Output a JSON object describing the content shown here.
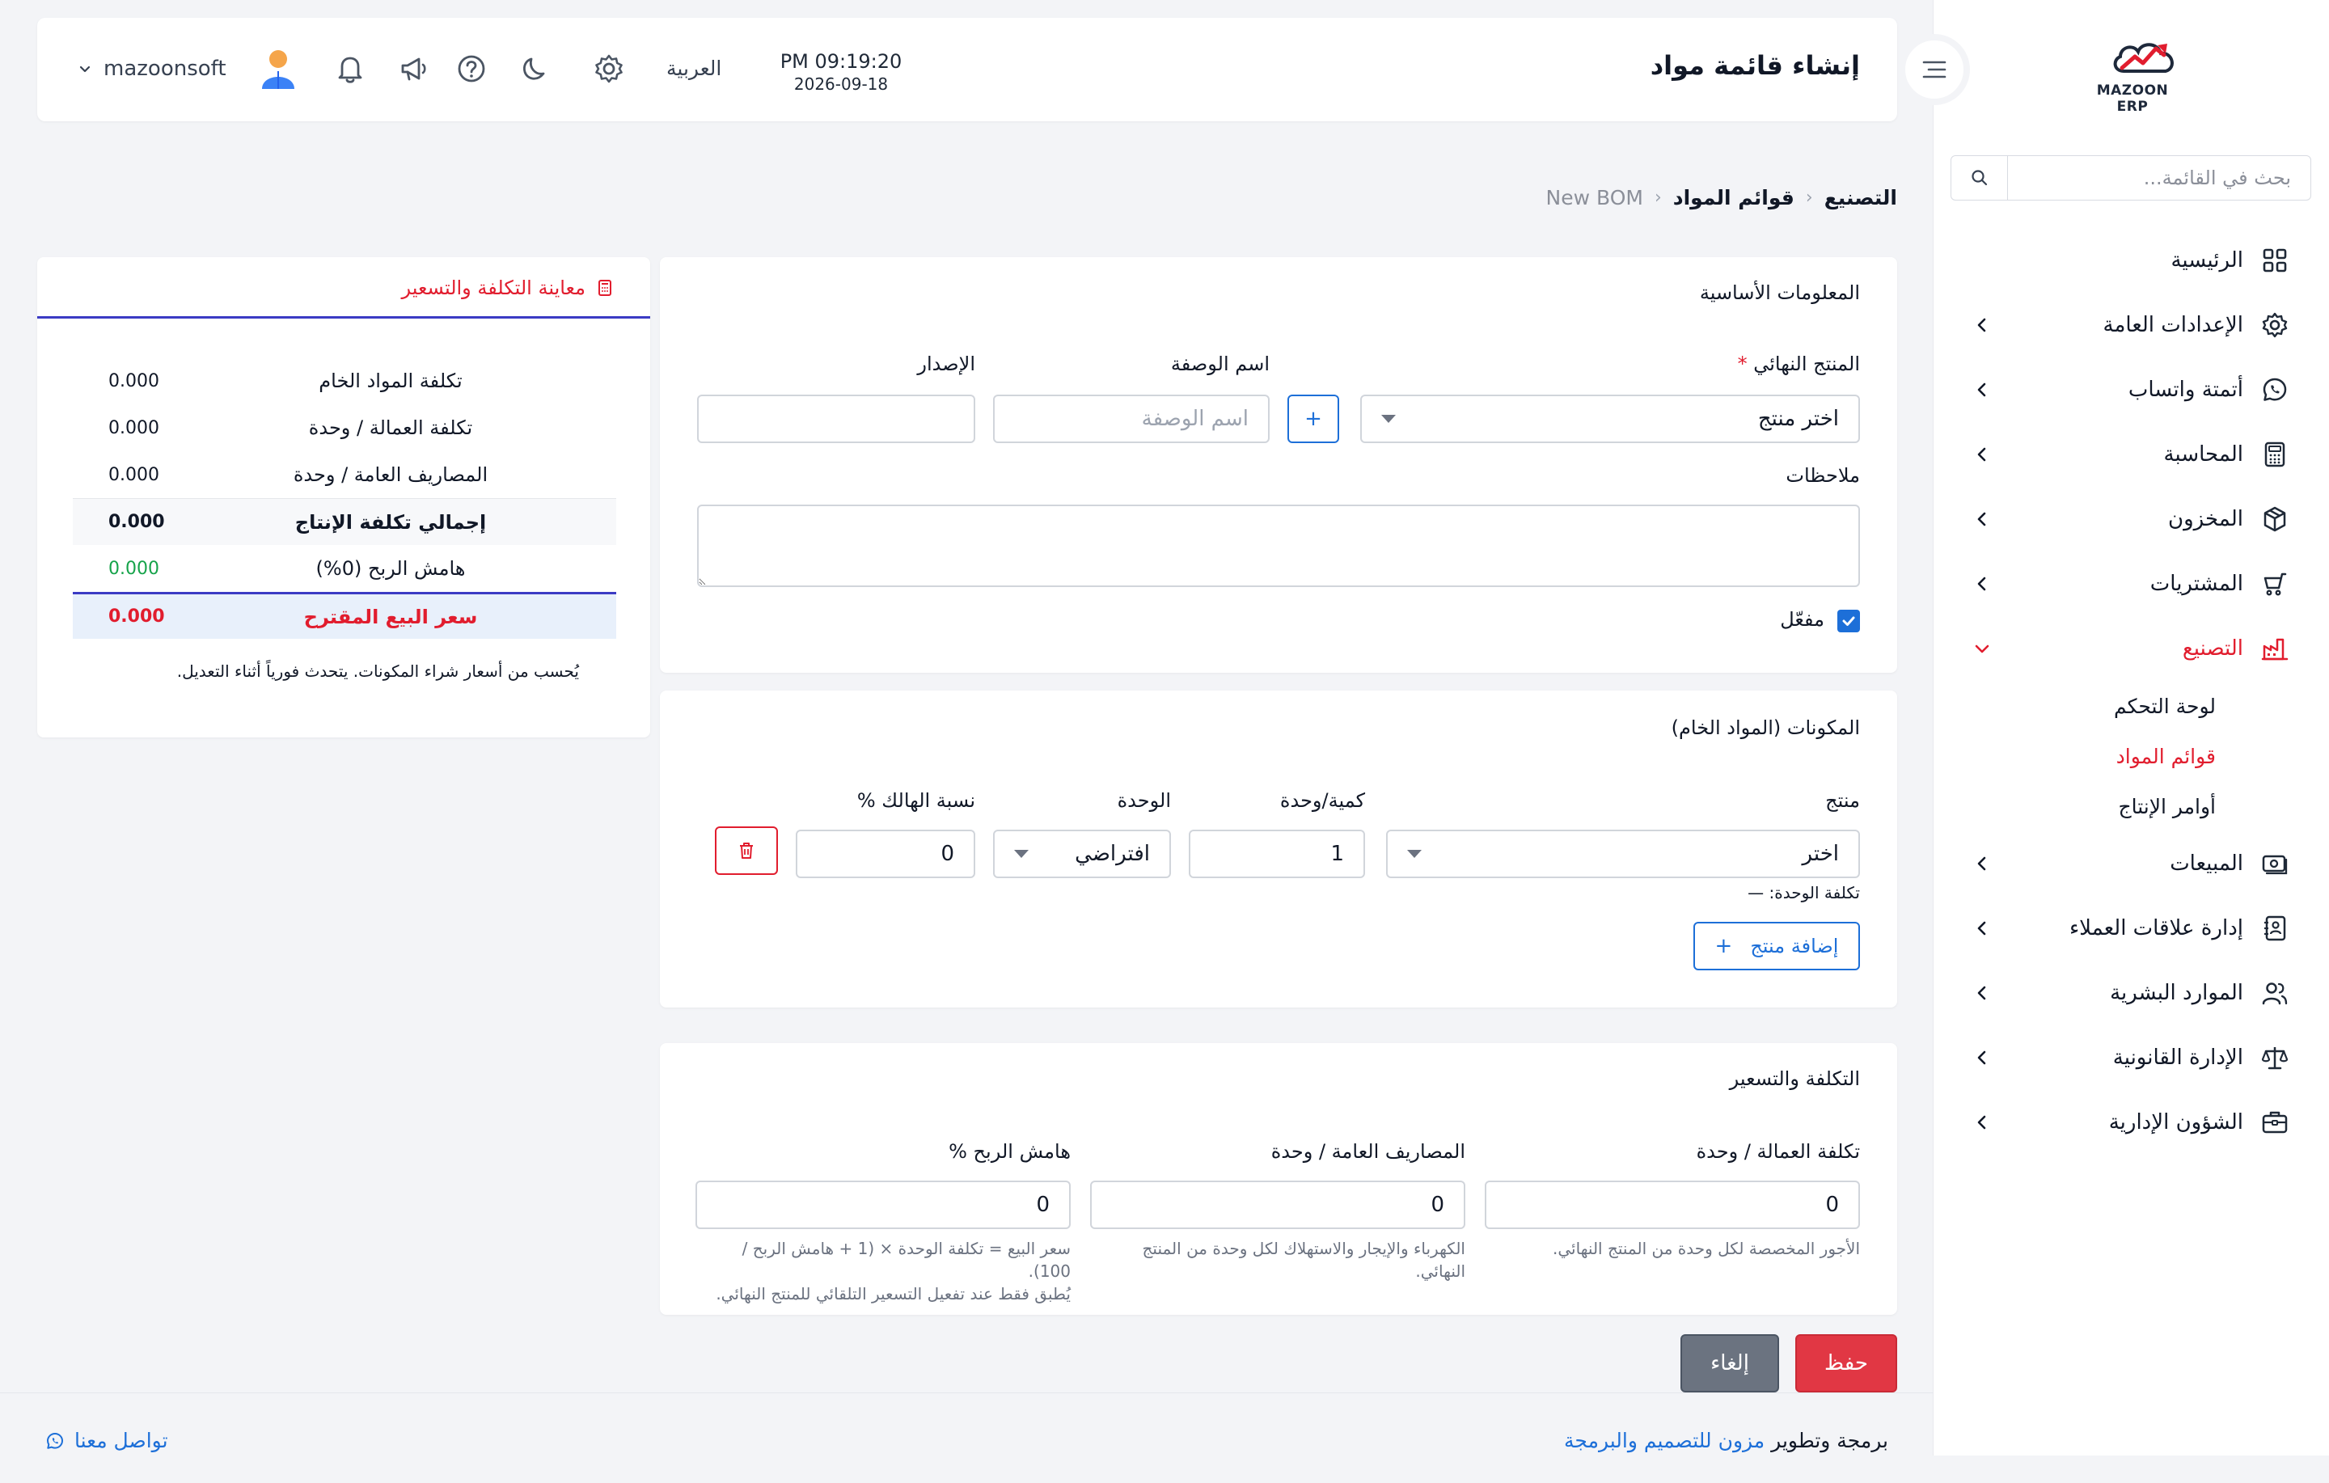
{
  "app": {
    "logo_text": "MAZOON ERP",
    "page_title": "إنشاء قائمة مواد"
  },
  "header": {
    "time": "PM 09:19:20",
    "date": "2026-09-18",
    "language": "العربية",
    "username": "mazoonsoft"
  },
  "sidebar": {
    "search_placeholder": "بحث في القائمة...",
    "items": [
      {
        "label": "الرئيسية",
        "icon": "grid-icon"
      },
      {
        "label": "الإعدادات العامة",
        "icon": "gear-icon"
      },
      {
        "label": "أتمتة واتساب",
        "icon": "whatsapp-icon"
      },
      {
        "label": "المحاسبة",
        "icon": "calculator-icon"
      },
      {
        "label": "المخزون",
        "icon": "box-icon"
      },
      {
        "label": "المشتريات",
        "icon": "cart-icon"
      },
      {
        "label": "التصنيع",
        "icon": "factory-icon"
      },
      {
        "label": "المبيعات",
        "icon": "cash-icon"
      },
      {
        "label": "إدارة علاقات العملاء",
        "icon": "contacts-icon"
      },
      {
        "label": "الموارد البشرية",
        "icon": "users-icon"
      },
      {
        "label": "الإدارة القانونية",
        "icon": "scale-icon"
      },
      {
        "label": "الشؤون الإدارية",
        "icon": "briefcase-icon"
      }
    ],
    "sub_items": [
      {
        "label": "لوحة التحكم"
      },
      {
        "label": "قوائم المواد"
      },
      {
        "label": "أوامر الإنتاج"
      }
    ]
  },
  "breadcrumb": {
    "items": [
      "التصنيع",
      "قوائم المواد",
      "New BOM"
    ]
  },
  "basic_info": {
    "title": "المعلومات الأساسية",
    "final_product_label": "المنتج النهائي",
    "required_mark": "*",
    "final_product_value": "اختر منتج",
    "add_symbol": "+",
    "recipe_name_label": "اسم الوصفة",
    "recipe_name_placeholder": "اسم الوصفة",
    "version_label": "الإصدار",
    "version_value": "",
    "notes_label": "ملاحظات",
    "notes_value": "",
    "enabled_label": "مفعّل"
  },
  "components": {
    "title": "المكونات (المواد الخام)",
    "product_label": "منتج",
    "product_value": "اختر",
    "qty_label": "كمية/وحدة",
    "qty_value": "1",
    "unit_label": "الوحدة",
    "unit_value": "افتراضي",
    "waste_label": "نسبة الهالك %",
    "waste_value": "0",
    "unit_cost_text": "تكلفة الوحدة: —",
    "add_product_label": "إضافة منتج",
    "add_symbol": "+"
  },
  "costing": {
    "title": "التكلفة والتسعير",
    "labor_label": "تكلفة العمالة / وحدة",
    "labor_value": "0",
    "labor_hint": "الأجور المخصصة لكل وحدة من المنتج النهائي.",
    "overhead_label": "المصاريف العامة / وحدة",
    "overhead_value": "0",
    "overhead_hint_1": "الكهرباء والإيجار والاستهلاك لكل وحدة من المنتج",
    "overhead_hint_2": "النهائي.",
    "margin_label": "هامش الربح %",
    "margin_value": "0",
    "margin_hint_1": "سعر البيع = تكلفة الوحدة × (1 + هامش الربح / 100).",
    "margin_hint_2": "يُطبق فقط عند تفعيل التسعير التلقائي للمنتج النهائي."
  },
  "preview": {
    "title": "معاينة التكلفة والتسعير",
    "rows": [
      {
        "label": "تكلفة المواد الخام",
        "value": "0.000"
      },
      {
        "label": "تكلفة العمالة / وحدة",
        "value": "0.000"
      },
      {
        "label": "المصاريف العامة / وحدة",
        "value": "0.000"
      },
      {
        "label": "إجمالي تكلفة الإنتاج",
        "value": "0.000"
      },
      {
        "label": "هامش الربح (0%)",
        "value": "0.000"
      },
      {
        "label": "سعر البيع المقترح",
        "value": "0.000"
      }
    ],
    "note": "يُحسب من أسعار شراء المكونات. يتحدث فورياً أثناء التعديل."
  },
  "actions": {
    "save_label": "حفظ",
    "cancel_label": "إلغاء"
  },
  "footer": {
    "credit_prefix": "برمجة وتطوير",
    "credit_brand": "مزون للتصميم والبرمجة",
    "contact_label": "تواصل معنا"
  },
  "colors": {
    "accent_red": "#e11d2e",
    "link_blue": "#1d6fd8",
    "checkbox_blue": "#1d6fd8",
    "preview_border": "#3b3bc4",
    "success_green": "#16a34a"
  }
}
